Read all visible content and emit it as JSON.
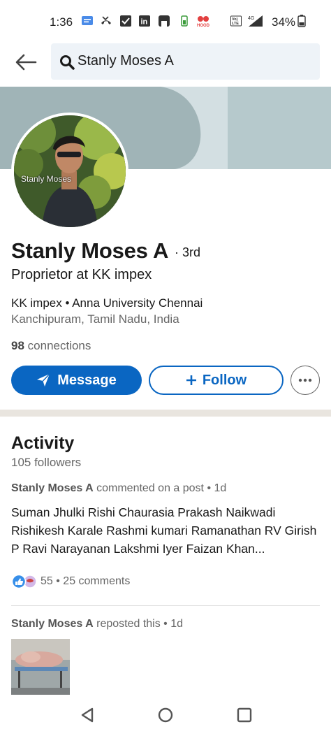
{
  "status_bar": {
    "time": "1:36",
    "network": "4G",
    "volte": "Vo) LTE",
    "battery": "34%",
    "icons": [
      "messages-icon",
      "missed-call-icon",
      "checkbox-icon",
      "linkedin-icon",
      "app-icon",
      "battery-saver-icon",
      "hood-app-icon",
      "volte-icon",
      "signal-icon",
      "battery-icon"
    ]
  },
  "search": {
    "query": "Stanly Moses A"
  },
  "profile": {
    "avatar_watermark": "Stanly Moses",
    "name": "Stanly Moses A",
    "degree": "· 3rd",
    "headline": "Proprietor at KK impex",
    "company_line": "KK impex • Anna University Chennai",
    "location": "Kanchipuram, Tamil Nadu, India",
    "connections_count": "98",
    "connections_label": "connections"
  },
  "actions": {
    "message_label": "Message",
    "follow_label": "Follow"
  },
  "activity": {
    "title": "Activity",
    "followers": "105 followers",
    "post1": {
      "author": "Stanly Moses A",
      "action": "commented on a post • 1d",
      "body": "Suman Jhulki Rishi Chaurasia Prakash Naikwadi Rishikesh Karale Rashmi kumari Ramanathan RV Girish P Ravi Narayanan Lakshmi Iyer Faizan Khan...",
      "reactions": "55 • 25 comments"
    },
    "post2": {
      "author": "Stanly Moses A",
      "action": "reposted this • 1d"
    }
  },
  "colors": {
    "brand_blue": "#0a66c2",
    "cover": "#a0b4b7",
    "divider_band": "#e9e5df"
  }
}
